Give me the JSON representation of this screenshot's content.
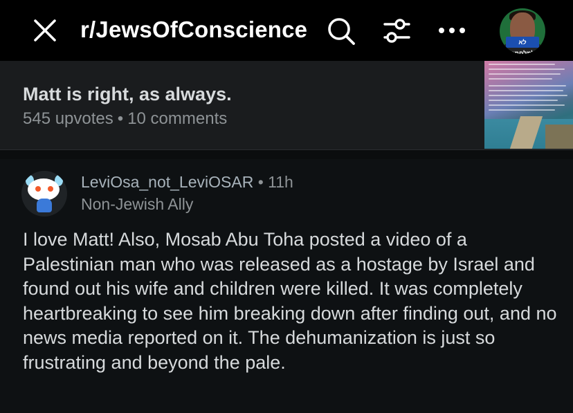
{
  "header": {
    "subreddit": "r/JewsOfConscience",
    "avatar_text": "לא למלחמה",
    "icons": {
      "close": "close-icon",
      "search": "search-icon",
      "filter": "filter-icon",
      "more": "more-icon"
    }
  },
  "post": {
    "title": "Matt is right, as always.",
    "upvotes": "545 upvotes",
    "separator": "•",
    "comments": "10 comments"
  },
  "comment": {
    "username": "LeviOsa_not_LeviOSAR",
    "separator": "•",
    "age": "11h",
    "flair": "Non-Jewish Ally",
    "body": "I love Matt! Also, Mosab Abu Toha posted a video of a Palestinian man who was released as a hostage by Israel and found out his wife and children were killed. It was completely heartbreaking to see him breaking down after finding out, and no news media reported on it. The dehumanization is just so frustrating and beyond the pale."
  },
  "colors": {
    "background": "#0e1113",
    "topbar": "#000000",
    "card": "#1a1c1e",
    "text": "#d7dadc",
    "muted": "#8e9396"
  }
}
